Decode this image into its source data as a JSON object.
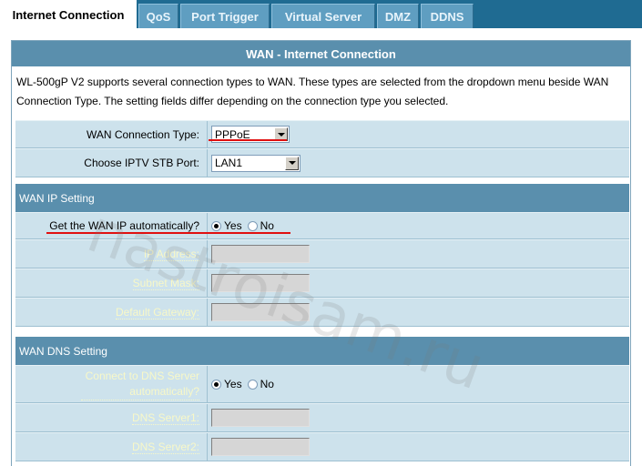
{
  "tabs": [
    {
      "label": "Internet Connection",
      "active": true
    },
    {
      "label": "QoS",
      "active": false
    },
    {
      "label": "Port Trigger",
      "active": false
    },
    {
      "label": "Virtual Server",
      "active": false
    },
    {
      "label": "DMZ",
      "active": false
    },
    {
      "label": "DDNS",
      "active": false
    }
  ],
  "header": {
    "title": "WAN - Internet Connection"
  },
  "description": "WL-500gP V2 supports several connection types to WAN. These types are selected from the dropdown menu beside WAN Connection Type. The setting fields differ depending on the connection type you selected.",
  "connection": {
    "type_label": "WAN Connection Type:",
    "type_value": "PPPoE",
    "iptv_label": "Choose IPTV STB Port:",
    "iptv_value": "LAN1"
  },
  "wan_ip": {
    "section_title": "WAN IP Setting",
    "auto_label": "Get the WAN IP automatically?",
    "yes_label": "Yes",
    "no_label": "No",
    "auto_selected": "Yes",
    "ip_label": "IP Address:",
    "ip_value": "",
    "mask_label": "Subnet Mask:",
    "mask_value": "",
    "gateway_label": "Default Gateway:",
    "gateway_value": ""
  },
  "wan_dns": {
    "section_title": "WAN DNS Setting",
    "auto_label": "Connect to DNS Server automatically?",
    "yes_label": "Yes",
    "no_label": "No",
    "auto_selected": "Yes",
    "dns1_label": "DNS Server1:",
    "dns1_value": "",
    "dns2_label": "DNS Server2:",
    "dns2_value": ""
  },
  "watermark": "nastroisam.ru",
  "colors": {
    "tabbar": "#1f6b92",
    "section": "#5a8fad",
    "row": "#cde2ec",
    "highlight": "#e01010"
  }
}
